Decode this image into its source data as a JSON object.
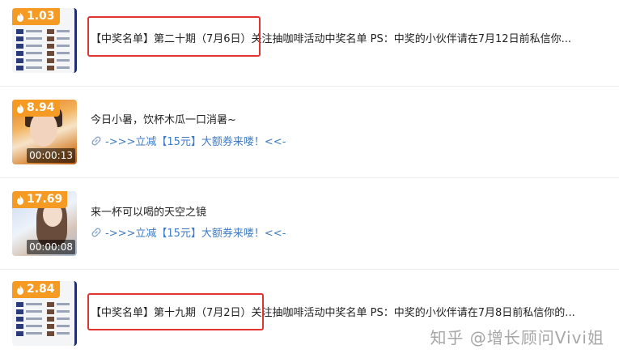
{
  "feed": {
    "items": [
      {
        "heat": "1.03",
        "title": "【中奖名单】第二十期（7月6日）关注抽咖啡活动中奖名单 PS：中奖的小伙伴请在7月12日前私信你..."
      },
      {
        "heat": "8.94",
        "duration": "00:00:13",
        "title": "今日小暑，饮杯木瓜一口消暑~",
        "link": "->>>立减【15元】大额券来喽！<<-"
      },
      {
        "heat": "17.69",
        "duration": "00:00:08",
        "title": "来一杯可以喝的天空之镜",
        "link": "->>>立减【15元】大额券来喽！<<-"
      },
      {
        "heat": "2.84",
        "title": "【中奖名单】第十九期（7月2日）关注抽咖啡活动中奖名单 PS：中奖的小伙伴请在7月8日前私信你的..."
      }
    ]
  },
  "watermark": "知乎 @增长顾问Vivi姐",
  "colors": {
    "heat_badge": "#f59a23",
    "link": "#3e7bc4",
    "highlight_box": "#e03430"
  },
  "icons": [
    "flame-icon",
    "link-icon"
  ]
}
